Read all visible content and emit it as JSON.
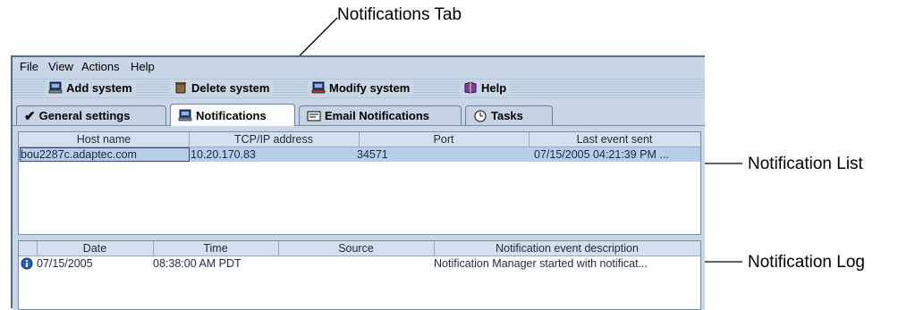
{
  "callouts": {
    "notifications_tab": "Notifications Tab",
    "notification_list": "Notification List",
    "notification_log": "Notification Log"
  },
  "menu": {
    "file": "File",
    "view": "View",
    "actions": "Actions",
    "help": "Help"
  },
  "toolbar": {
    "add_system": "Add system",
    "delete_system": "Delete system",
    "modify_system": "Modify system",
    "help": "Help"
  },
  "tabs": [
    {
      "label": "General settings",
      "icon": "checkmark-icon"
    },
    {
      "label": "Notifications",
      "icon": "computer-icon",
      "active": true
    },
    {
      "label": "Email Notifications",
      "icon": "envelope-icon"
    },
    {
      "label": "Tasks",
      "icon": "clock-icon"
    }
  ],
  "notification_list": {
    "columns": [
      "Host name",
      "TCP/IP address",
      "Port",
      "Last event sent"
    ],
    "rows": [
      {
        "host": "bou2287c.adaptec.com",
        "ip": "10.20.170.83",
        "port": "34571",
        "last": "07/15/2005 04:21:39 PM ..."
      }
    ]
  },
  "notification_log": {
    "columns": [
      "Date",
      "Time",
      "Source",
      "Notification event description"
    ],
    "rows": [
      {
        "icon": "info-icon",
        "date": "07/15/2005",
        "time": "08:38:00 AM PDT",
        "source": "",
        "description": "Notification Manager started with notificat..."
      }
    ]
  },
  "colors": {
    "window_bg": "#c9d6e6",
    "selection": "#b8cdea",
    "text": "#1c2a3e"
  }
}
